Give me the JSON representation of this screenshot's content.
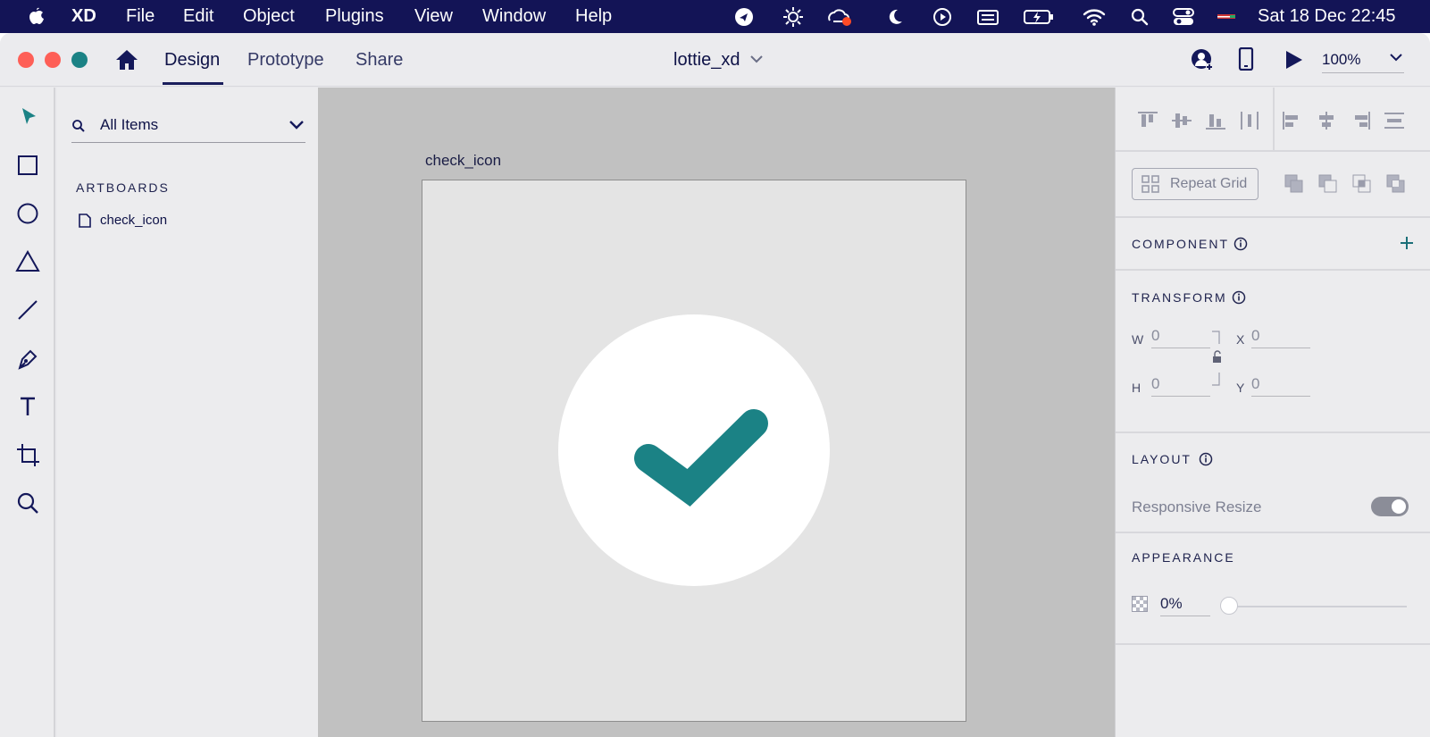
{
  "menubar": {
    "app_name": "XD",
    "menus": [
      "File",
      "Edit",
      "Object",
      "Plugins",
      "View",
      "Window",
      "Help"
    ],
    "clock": "Sat 18 Dec  22:45"
  },
  "toolbar": {
    "tabs": [
      "Design",
      "Prototype",
      "Share"
    ],
    "active_tab": "Design",
    "document_title": "lottie_xd",
    "zoom": "100%"
  },
  "layers": {
    "filter_label": "All Items",
    "section_label": "ARTBOARDS",
    "items": [
      "check_icon"
    ]
  },
  "canvas": {
    "artboard_name": "check_icon",
    "accent_color": "#1b8285"
  },
  "properties": {
    "repeat_grid_label": "Repeat Grid",
    "component_title": "COMPONENT",
    "transform_title": "TRANSFORM",
    "w_label": "W",
    "w_value": "0",
    "h_label": "H",
    "h_value": "0",
    "x_label": "X",
    "x_value": "0",
    "y_label": "Y",
    "y_value": "0",
    "layout_title": "LAYOUT",
    "responsive_resize_label": "Responsive Resize",
    "appearance_title": "APPEARANCE",
    "opacity_value": "0%"
  }
}
